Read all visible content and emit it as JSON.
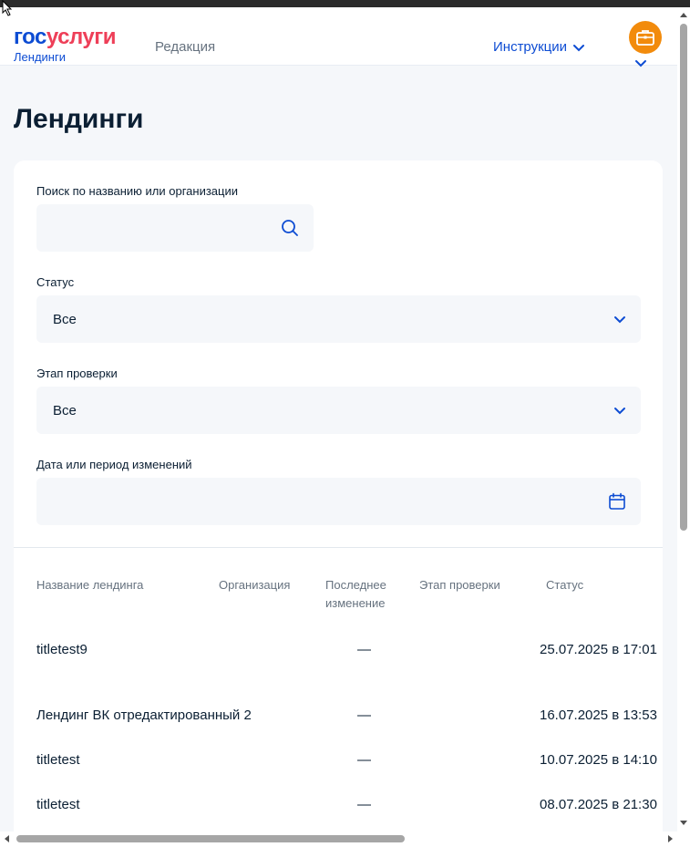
{
  "header": {
    "logo_part1": "гос",
    "logo_part2": "услуги",
    "logo_sub": "Лендинги",
    "nav_edit": "Редакция",
    "nav_instructions": "Инструкции"
  },
  "page": {
    "title": "Лендинги"
  },
  "filters": {
    "search_label": "Поиск по названию или организации",
    "search_value": "",
    "status_label": "Статус",
    "status_value": "Все",
    "stage_label": "Этап проверки",
    "stage_value": "Все",
    "date_label": "Дата или период изменений",
    "date_value": ""
  },
  "table": {
    "columns": [
      "Название лендинга",
      "Организация",
      "Последнее изменение",
      "Этап проверки",
      "Статус"
    ],
    "rows": [
      {
        "name": "titletest9",
        "org": "—",
        "date": "25.07.2025 в 17:01"
      },
      {
        "name": "Лендинг ВК отредактированный 2",
        "org": "—",
        "date": "16.07.2025 в 13:53"
      },
      {
        "name": "titletest",
        "org": "—",
        "date": "10.07.2025 в 14:10"
      },
      {
        "name": "titletest",
        "org": "—",
        "date": "08.07.2025 в 21:30"
      }
    ]
  },
  "colors": {
    "brand_blue": "#0d4cd3",
    "brand_red": "#ee3f58",
    "avatar_orange": "#f28b0c"
  }
}
